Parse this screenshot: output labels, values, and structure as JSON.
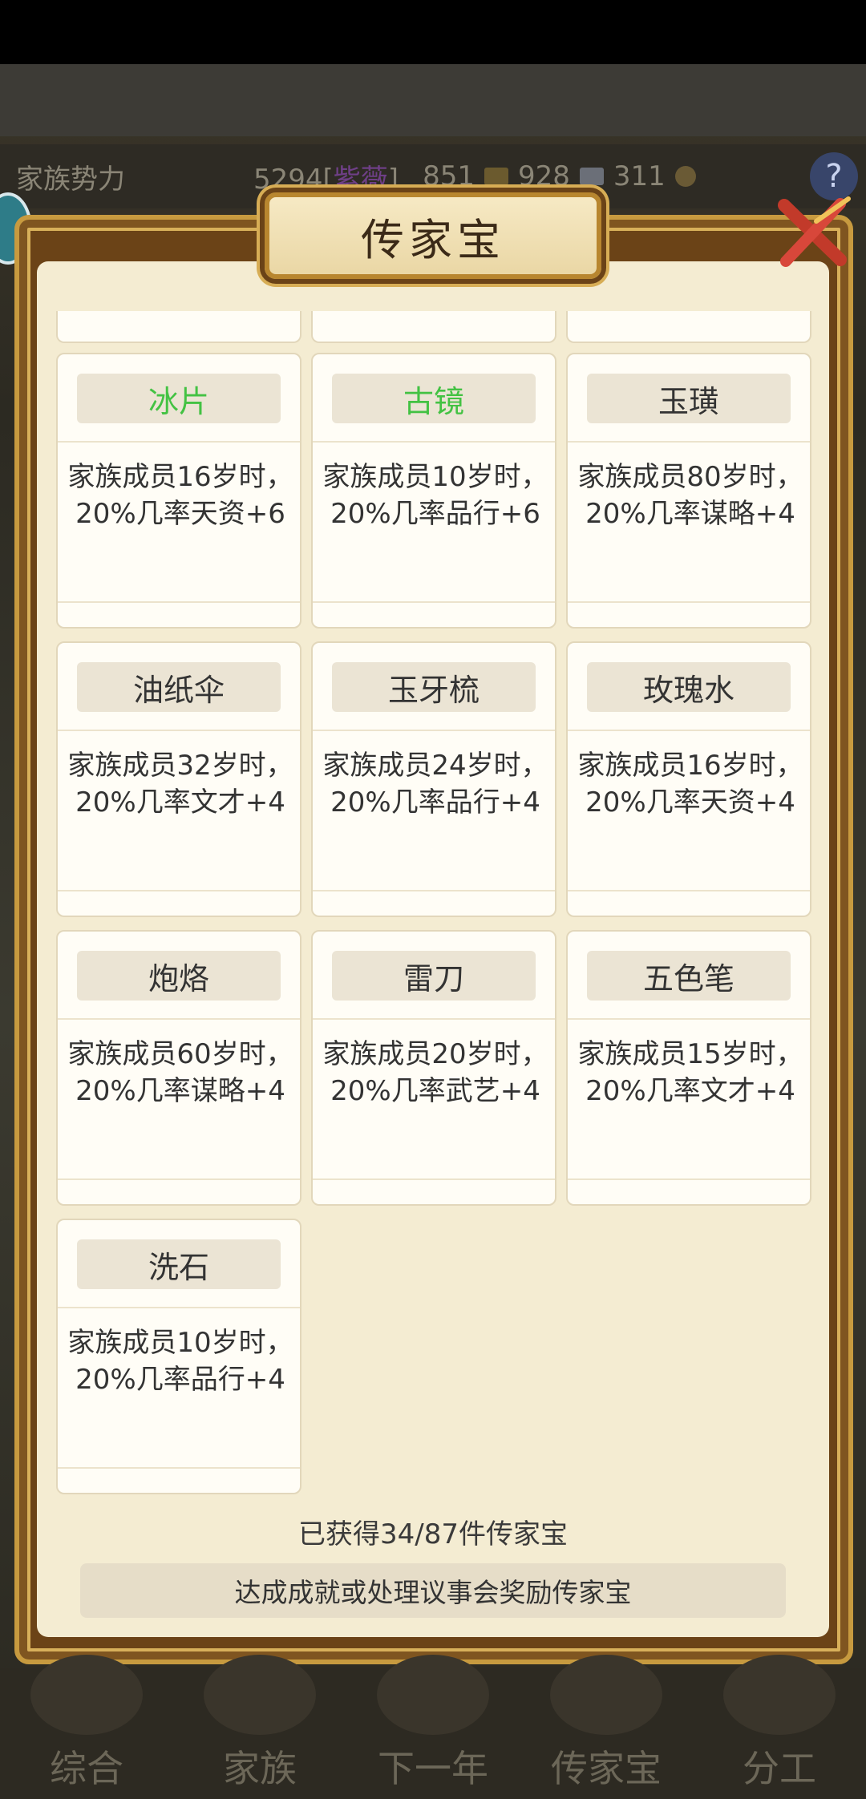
{
  "top": {
    "family_power_label": "家族势力",
    "family_power_value": "5294",
    "family_power_rank": "紫薇",
    "resource_1": "851",
    "resource_2": "928",
    "resource_3": "311"
  },
  "dialog": {
    "title": "传家宝",
    "items": [
      {
        "name": "冰片",
        "desc": "家族成员16岁时，20%几率天资+6",
        "highlight": true
      },
      {
        "name": "古镜",
        "desc": "家族成员10岁时，20%几率品行+6",
        "highlight": true
      },
      {
        "name": "玉璜",
        "desc": "家族成员80岁时，20%几率谋略+4",
        "highlight": false
      },
      {
        "name": "油纸伞",
        "desc": "家族成员32岁时，20%几率文才+4",
        "highlight": false
      },
      {
        "name": "玉牙梳",
        "desc": "家族成员24岁时，20%几率品行+4",
        "highlight": false
      },
      {
        "name": "玫瑰水",
        "desc": "家族成员16岁时，20%几率天资+4",
        "highlight": false
      },
      {
        "name": "炮烙",
        "desc": "家族成员60岁时，20%几率谋略+4",
        "highlight": false
      },
      {
        "name": "雷刀",
        "desc": "家族成员20岁时，20%几率武艺+4",
        "highlight": false
      },
      {
        "name": "五色笔",
        "desc": "家族成员15岁时，20%几率文才+4",
        "highlight": false
      },
      {
        "name": "洗石",
        "desc": "家族成员10岁时，20%几率品行+4",
        "highlight": false
      }
    ],
    "count_text": "已获得34/87件传家宝",
    "hint_button": "达成成就或处理议事会奖励传家宝"
  },
  "colors": {
    "highlight_green": "#43c243",
    "panel_gold": "#c79a3f",
    "panel_bg": "#f4ecd2"
  },
  "bottom_nav": [
    "综合",
    "家族",
    "下一年",
    "传家宝",
    "分工"
  ]
}
